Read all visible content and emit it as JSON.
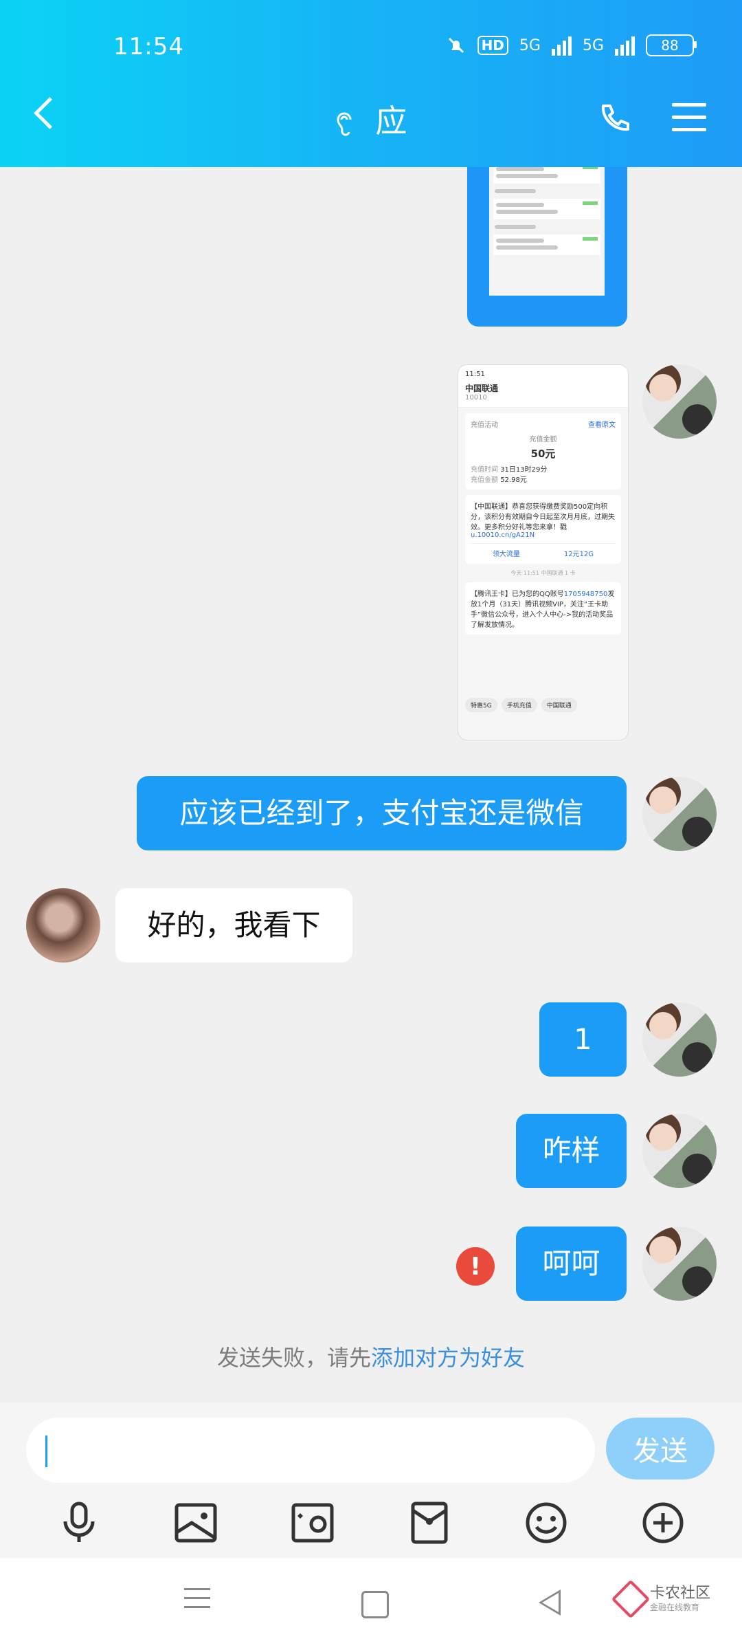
{
  "status": {
    "time": "11:54",
    "battery": "88",
    "hd": "HD",
    "network1": "5G",
    "network2": "5G"
  },
  "header": {
    "title": "应"
  },
  "messages": {
    "m1": "应该已经到了，支付宝还是微信",
    "m2": "好的，我看下",
    "m3": "1",
    "m4": "咋样",
    "m5": "呵呵"
  },
  "system_notice": {
    "prefix": "发送失败，请先",
    "link": "添加对方为好友"
  },
  "input": {
    "placeholder": "",
    "send_label": "发送"
  },
  "screenshot2": {
    "time": "11:51",
    "sender": "中国联通",
    "sender_num": "10010",
    "card_tag": "充值活动",
    "card_tag_right": "查看原文",
    "amount_label": "充值金额",
    "amount": "50元",
    "row1_label": "充值时间",
    "row1_value": "31日13时29分",
    "row2_label": "充值金额",
    "row2_value": "52.98元",
    "sms1": "【中国联通】恭喜您获得缴费奖励500定向积分，该积分有效期自今日起至次月月底，过期失效。更多积分好礼等您来拿！戳",
    "sms1_link": "u.10010.cn/gA21N",
    "btn1": "领大流量",
    "btn2": "12元12G",
    "divider": "今天 11:51 中国联通 1 卡",
    "sms2_a": "【腾讯王卡】已为您的QQ账号",
    "sms2_num": "1705948750",
    "sms2_b": "发放1个月（31天）腾讯视频VIP，关注“王卡助手”微信公众号，进入个人中心->我的活动奖品了解发放情况。",
    "chip1": "特惠5G",
    "chip2": "手机充值",
    "chip3": "中国联通"
  },
  "watermark": {
    "title": "卡农社区",
    "subtitle": "金融在线教育"
  },
  "icons": [
    "back-icon",
    "ear-icon",
    "phone-icon",
    "menu-icon",
    "microphone-icon",
    "image-icon",
    "camera-icon",
    "red-packet-icon",
    "emoji-icon",
    "plus-icon",
    "error-icon"
  ]
}
